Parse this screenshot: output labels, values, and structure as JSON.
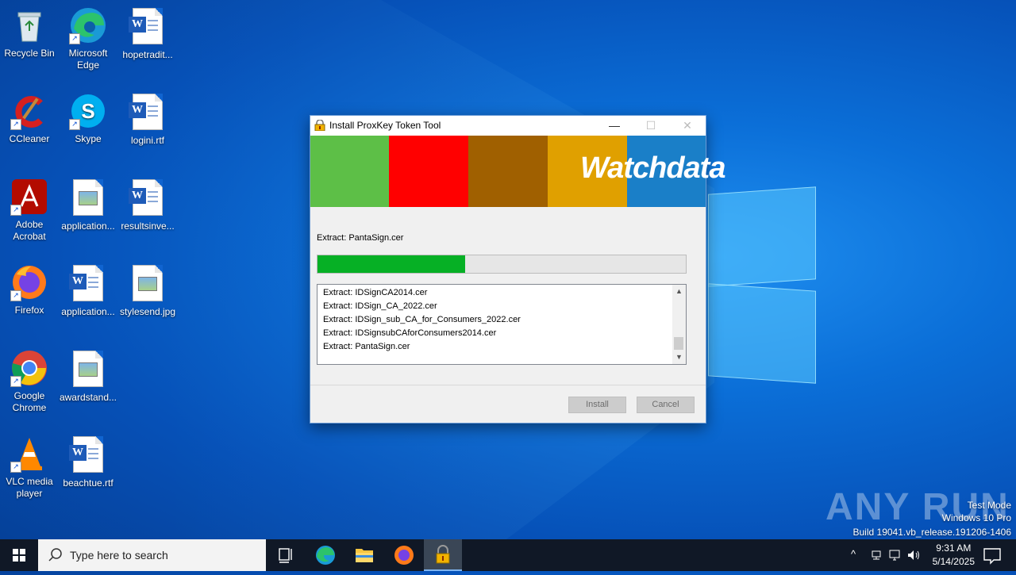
{
  "desktop": {
    "icons": [
      {
        "label": "Recycle Bin",
        "icon": "recycle-bin-icon"
      },
      {
        "label": "Microsoft Edge",
        "icon": "edge-icon"
      },
      {
        "label": "hopetradit...",
        "icon": "word-document-icon"
      },
      {
        "label": "CCleaner",
        "icon": "ccleaner-icon"
      },
      {
        "label": "Skype",
        "icon": "skype-icon"
      },
      {
        "label": "logini.rtf",
        "icon": "word-document-icon"
      },
      {
        "label": "Adobe Acrobat",
        "icon": "acrobat-icon"
      },
      {
        "label": "application...",
        "icon": "image-file-icon"
      },
      {
        "label": "resultsinve...",
        "icon": "word-document-icon"
      },
      {
        "label": "Firefox",
        "icon": "firefox-icon"
      },
      {
        "label": "application...",
        "icon": "word-document-icon"
      },
      {
        "label": "stylesend.jpg",
        "icon": "image-file-icon"
      },
      {
        "label": "Google Chrome",
        "icon": "chrome-icon"
      },
      {
        "label": "awardstand...",
        "icon": "image-file-icon"
      },
      {
        "label": "VLC media player",
        "icon": "vlc-icon"
      },
      {
        "label": "beachtue.rtf",
        "icon": "word-document-icon"
      }
    ]
  },
  "dialog": {
    "title": "Install ProxKey Token Tool",
    "banner_logo": "Watchdata",
    "banner_colors": [
      "#5dbf47",
      "#ff0000",
      "#a06000",
      "#e0a000",
      "#1a7fc8"
    ],
    "status_text": "Extract: PantaSign.cer",
    "progress": 0.4,
    "log": [
      "Extract: IDSignCA2014.cer",
      "Extract: IDSign_CA_2022.cer",
      "Extract: IDSign_sub_CA_for_Consumers_2022.cer",
      "Extract: IDSignsubCAforConsumers2014.cer",
      "Extract: PantaSign.cer"
    ],
    "install_label": "Install",
    "cancel_label": "Cancel"
  },
  "watermark": {
    "brand": "ANY RUN",
    "mode": "Test Mode",
    "os": "Windows 10 Pro",
    "build": "Build 19041.vb_release.191206-1406"
  },
  "taskbar": {
    "search_placeholder": "Type here to search",
    "time": "9:31 AM",
    "date": "5/14/2025",
    "pinned": [
      "task-view-icon",
      "edge-icon",
      "file-explorer-icon",
      "firefox-icon",
      "installer-lock-icon"
    ]
  }
}
